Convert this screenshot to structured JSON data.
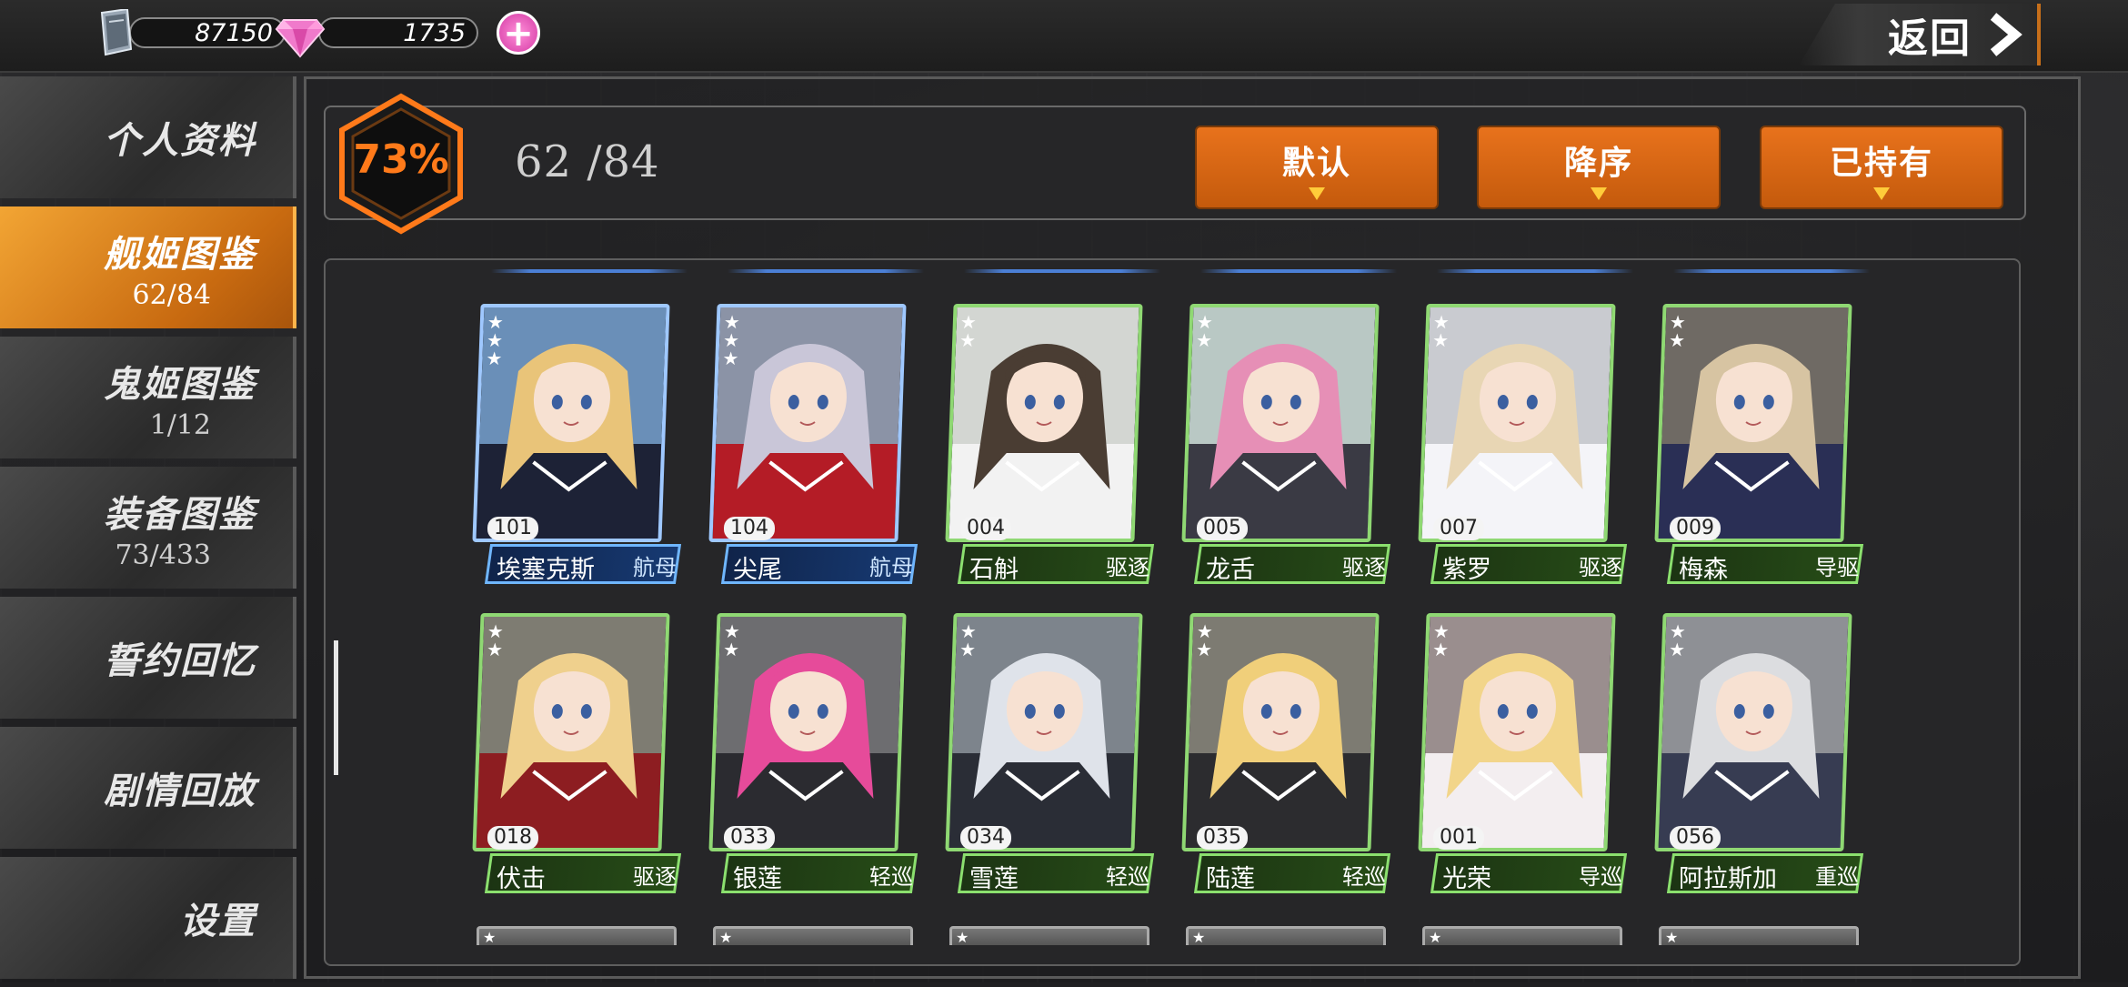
{
  "topbar": {
    "books": "87150",
    "gems": "1735",
    "back_label": "返回",
    "icons": {
      "books": "book-stack-icon",
      "gems": "pink-diamond-icon",
      "add": "plus-icon",
      "back": "chevron-right-icon"
    }
  },
  "sidebar": {
    "items": [
      {
        "label": "个人资料",
        "count": ""
      },
      {
        "label": "舰姬图鉴",
        "count": "62/84",
        "active": true
      },
      {
        "label": "鬼姬图鉴",
        "count": "1/12"
      },
      {
        "label": "装备图鉴",
        "count": "73/433"
      },
      {
        "label": "誓约回忆",
        "count": ""
      },
      {
        "label": "剧情回放",
        "count": ""
      },
      {
        "label": "设置",
        "count": ""
      }
    ]
  },
  "header": {
    "percent": "73%",
    "count": "62 /84",
    "filters": [
      "默认",
      "降序",
      "已持有"
    ]
  },
  "colors": {
    "accent": "#e8721c",
    "green_frame": "#8be06e",
    "blue_frame": "#6fb6ff",
    "percent_text": "#ff7a1a"
  },
  "cards": [
    {
      "num": "101",
      "name": "埃塞克斯",
      "type": "航母",
      "stars": 3,
      "frame": "blue",
      "hair": "#e9c479",
      "bg": "#6a8fb8",
      "outfit": "#1d2236"
    },
    {
      "num": "104",
      "name": "尖尾",
      "type": "航母",
      "stars": 3,
      "frame": "blue",
      "hair": "#c9c6d8",
      "bg": "#8b93a6",
      "outfit": "#b41c26"
    },
    {
      "num": "004",
      "name": "石斛",
      "type": "驱逐",
      "stars": 2,
      "frame": "green",
      "hair": "#4a3d33",
      "bg": "#d3d6d2",
      "outfit": "#f2f2f2"
    },
    {
      "num": "005",
      "name": "龙舌",
      "type": "驱逐",
      "stars": 2,
      "frame": "green",
      "hair": "#e68fb6",
      "bg": "#b9c8c4",
      "outfit": "#3a3a44"
    },
    {
      "num": "007",
      "name": "紫罗",
      "type": "驱逐",
      "stars": 2,
      "frame": "green",
      "hair": "#e8d6b4",
      "bg": "#c9cbd0",
      "outfit": "#f4f4f8"
    },
    {
      "num": "009",
      "name": "梅森",
      "type": "导驱",
      "stars": 2,
      "frame": "green",
      "hair": "#d7c4a2",
      "bg": "#6f6a64",
      "outfit": "#2a2f55"
    },
    {
      "num": "018",
      "name": "伏击",
      "type": "驱逐",
      "stars": 2,
      "frame": "green",
      "hair": "#efd08d",
      "bg": "#7e7c72",
      "outfit": "#8d1d21"
    },
    {
      "num": "033",
      "name": "银莲",
      "type": "轻巡",
      "stars": 2,
      "frame": "green",
      "hair": "#e64b9a",
      "bg": "#6d6d70",
      "outfit": "#2b2b30"
    },
    {
      "num": "034",
      "name": "雪莲",
      "type": "轻巡",
      "stars": 2,
      "frame": "green",
      "hair": "#dfe3ea",
      "bg": "#7d848c",
      "outfit": "#2a2d36"
    },
    {
      "num": "035",
      "name": "陆莲",
      "type": "轻巡",
      "stars": 2,
      "frame": "green",
      "hair": "#f0cf7a",
      "bg": "#7d7b72",
      "outfit": "#2c2c2f"
    },
    {
      "num": "001",
      "name": "光荣",
      "type": "导巡",
      "stars": 2,
      "frame": "green",
      "hair": "#f2d58a",
      "bg": "#9a8e8e",
      "outfit": "#f3eef0"
    },
    {
      "num": "056",
      "name": "阿拉斯加",
      "type": "重巡",
      "stars": 2,
      "frame": "green",
      "hair": "#dcdde0",
      "bg": "#8e9095",
      "outfit": "#373c52"
    }
  ]
}
